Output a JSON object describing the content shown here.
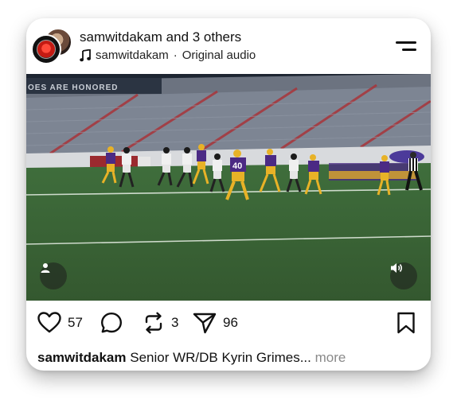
{
  "header": {
    "username": "samwitdakam",
    "collab_text": "and 3 others",
    "audio_owner": "samwitdakam",
    "audio_separator": "·",
    "audio_label": "Original audio"
  },
  "media": {
    "banner_text": "OES ARE HONORED",
    "jersey_number": "40"
  },
  "actions": {
    "like_count": "57",
    "repost_count": "3",
    "share_count": "96"
  },
  "caption": {
    "username": "samwitdakam",
    "text": "Senior WR/DB Kyrin Grimes...",
    "more_label": "more"
  },
  "colors": {
    "field_green": "#3e6a3a",
    "team_purple": "#4b2a84",
    "team_gold": "#e8b227",
    "seat_red": "#a8343a"
  },
  "icons": [
    "music-note-icon",
    "menu-icon",
    "person-icon",
    "volume-icon",
    "heart-icon",
    "comment-icon",
    "repost-icon",
    "share-icon",
    "bookmark-icon"
  ]
}
